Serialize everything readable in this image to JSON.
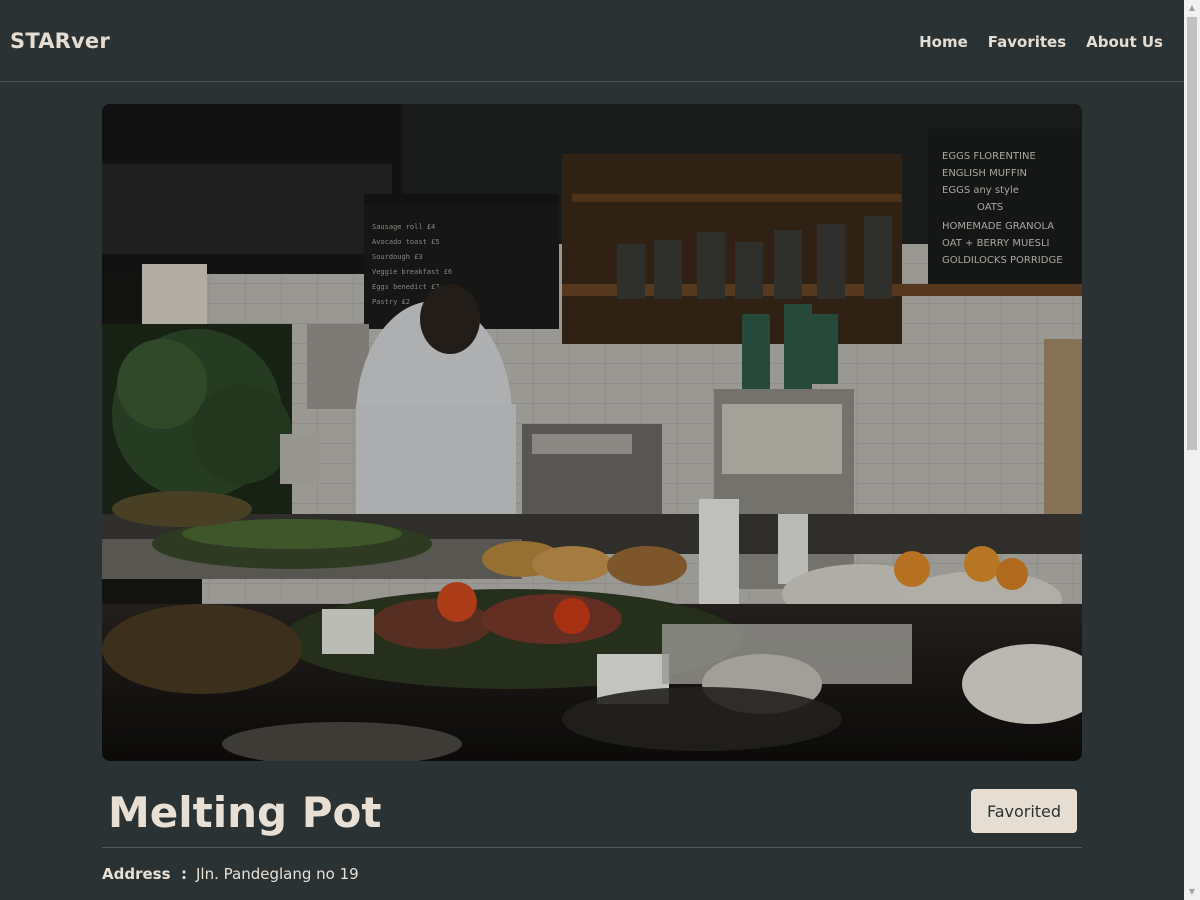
{
  "navbar": {
    "brand": "STARver",
    "links": [
      "Home",
      "Favorites",
      "About Us"
    ]
  },
  "hero": {
    "image": "cafe-counter-photo"
  },
  "restaurant": {
    "name": "Melting Pot",
    "favorite_label": "Favorited",
    "details": [
      {
        "label": "Address",
        "value": "Jln. Pandeglang no 19"
      }
    ]
  },
  "colors": {
    "background": "#2b3234",
    "text": "#e8e0d5",
    "button_bg": "#e6ded2"
  }
}
